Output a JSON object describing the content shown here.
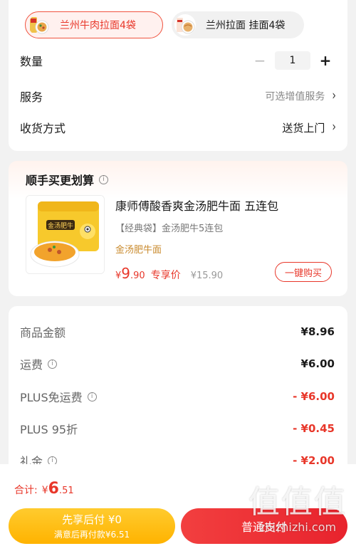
{
  "variants": [
    {
      "label": "兰州牛肉拉面4袋",
      "selected": true
    },
    {
      "label": "兰州拉面 挂面4袋",
      "selected": false
    }
  ],
  "quantity": {
    "label": "数量",
    "minus": "−",
    "value": "1",
    "plus": "+"
  },
  "service": {
    "label": "服务",
    "value": "可选增值服务"
  },
  "delivery": {
    "label": "收货方式",
    "value": "送货上门"
  },
  "bundle": {
    "title": "顺手买更划算",
    "product_title": "康师傅酸香爽金汤肥牛面 五连包",
    "product_sub": "【经典袋】金汤肥牛5连包",
    "variant": "金汤肥牛面",
    "price_currency": "¥",
    "price_int": "9",
    "price_dec": ".90",
    "price_tag": "专享价",
    "original_price": "¥15.90",
    "buy_label": "一键购买",
    "package_text": "金汤肥牛"
  },
  "fees": [
    {
      "label": "商品金额",
      "value": "¥8.96",
      "info": false,
      "red": false
    },
    {
      "label": "运费",
      "value": "¥6.00",
      "info": true,
      "red": false
    },
    {
      "label": "PLUS免运费",
      "value": "- ¥6.00",
      "info": true,
      "red": true
    },
    {
      "label": "PLUS 95折",
      "value": "- ¥0.45",
      "info": false,
      "red": true
    },
    {
      "label": "礼金",
      "value": "- ¥2.00",
      "info": true,
      "red": true
    }
  ],
  "footer": {
    "total_label": "合计:",
    "total_currency": "¥",
    "total_int": "6",
    "total_dec": ".51",
    "later_line1": "先享后付 ¥0",
    "later_line2": "满意后再付款¥6.51",
    "pay_label": "普通支付"
  },
  "watermark": {
    "line1": "值值值",
    "line2": "zhizhizhi.com"
  },
  "colors": {
    "accent_red": "#e8372a",
    "yellow": "#ffb300",
    "variant_gold": "#c98a2d"
  }
}
